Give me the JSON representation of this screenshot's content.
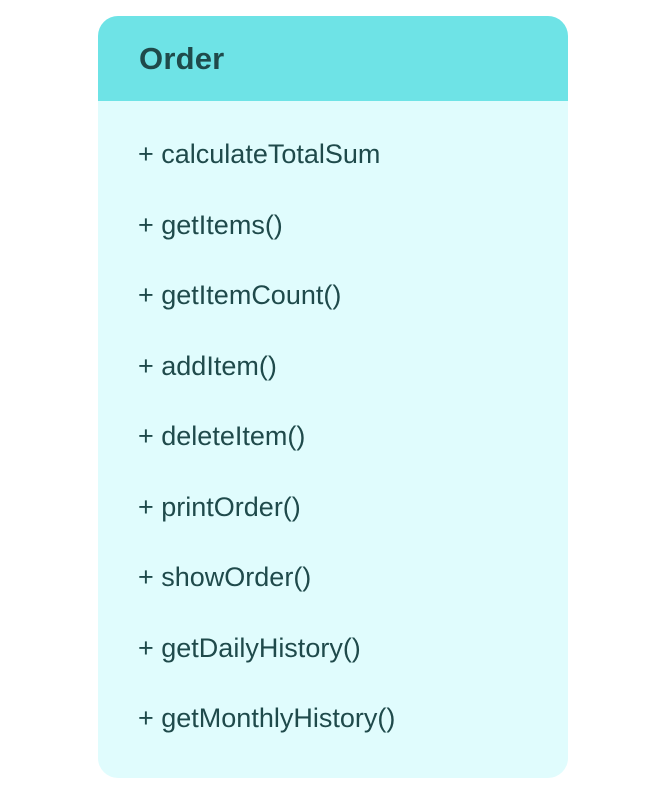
{
  "class": {
    "name": "Order",
    "methods": [
      "+ calculateTotalSum",
      "+ getItems()",
      "+ getItemCount()",
      "+ addItem()",
      "+ deleteItem()",
      "+ printOrder()",
      "+ showOrder()",
      "+ getDailyHistory()",
      "+ getMonthlyHistory()"
    ]
  },
  "colors": {
    "header_background": "#6ee3e6",
    "body_background": "#e0fcfd",
    "text": "#1f4a4b"
  }
}
